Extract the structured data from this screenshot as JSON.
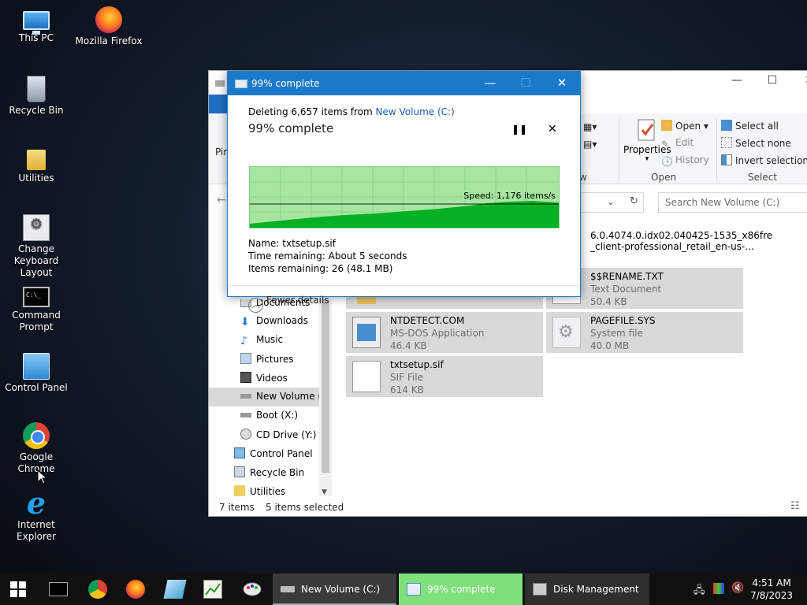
{
  "desktop": {
    "icons": [
      {
        "label": "This PC",
        "icon": "this-pc-icon"
      },
      {
        "label": "Mozilla Firefox",
        "icon": "firefox-icon"
      },
      {
        "label": "Recycle Bin",
        "icon": "recycle-bin-icon"
      },
      {
        "label": "Utilities",
        "icon": "folder-icon"
      },
      {
        "label": "Change Keyboard Layout",
        "icon": "keyboard-settings-icon"
      },
      {
        "label": "Command Prompt",
        "icon": "command-prompt-icon"
      },
      {
        "label": "Control Panel",
        "icon": "control-panel-icon"
      },
      {
        "label": "Google Chrome",
        "icon": "chrome-icon"
      },
      {
        "label": "Internet Explorer",
        "icon": "internet-explorer-icon"
      }
    ]
  },
  "explorer": {
    "ribbon": {
      "pin_partial": "Pin",
      "view_group_partial": "w",
      "properties": "Properties",
      "open": "Open",
      "edit": "Edit",
      "history": "History",
      "open_group": "Open",
      "select_all": "Select all",
      "select_none": "Select none",
      "invert_selection": "Invert selection",
      "select_group": "Select"
    },
    "search_placeholder": "Search New Volume (C:)",
    "nav_items": [
      "Documents",
      "Downloads",
      "Music",
      "Pictures",
      "Videos",
      "New Volume (C:)",
      "Boot (X:)",
      "CD Drive (Y:) H",
      "Control Panel",
      "Recycle Bin",
      "Utilities"
    ],
    "files": [
      {
        "name": "6.0.4074.0.idx02.040425-1535_x86fre",
        "type": "_client-professional_retail_en-us-...",
        "size": ""
      },
      {
        "name": "$$RENAME.TXT",
        "type": "Text Document",
        "size": "50.4 KB"
      },
      {
        "name": "NTDETECT.COM",
        "type": "MS-DOS Application",
        "size": "46.4 KB"
      },
      {
        "name": "PAGEFILE.SYS",
        "type": "System file",
        "size": "40.0 MB"
      },
      {
        "name": "txtsetup.sif",
        "type": "SIF File",
        "size": "614 KB"
      }
    ],
    "status": {
      "items": "7 items",
      "selected": "5 items selected"
    }
  },
  "dialog": {
    "title": "99% complete",
    "deleting_prefix": "Deleting 6,657 items from",
    "location": "New Volume (C:)",
    "heading": "99% complete",
    "speed": "Speed: 1,176 items/s",
    "name_label": "Name:",
    "name_value": "txtsetup.sif",
    "time_label": "Time remaining:",
    "time_value": "About 5 seconds",
    "items_label": "Items remaining:",
    "items_value": "26 (48.1 MB)",
    "fewer_details": "Fewer details",
    "progress_fraction": 0.99
  },
  "taskbar": {
    "tasks": [
      {
        "label": "New Volume (C:)"
      },
      {
        "label": "99% complete"
      },
      {
        "label": "Disk Management"
      }
    ],
    "time": "4:51 AM",
    "date": "7/8/2023"
  },
  "colors": {
    "title_blue": "#1979ca",
    "progress_green": "#06b025",
    "progress_bg": "#a6e6a0",
    "taskbar": "#101010",
    "active_task": "#7ee07a"
  }
}
